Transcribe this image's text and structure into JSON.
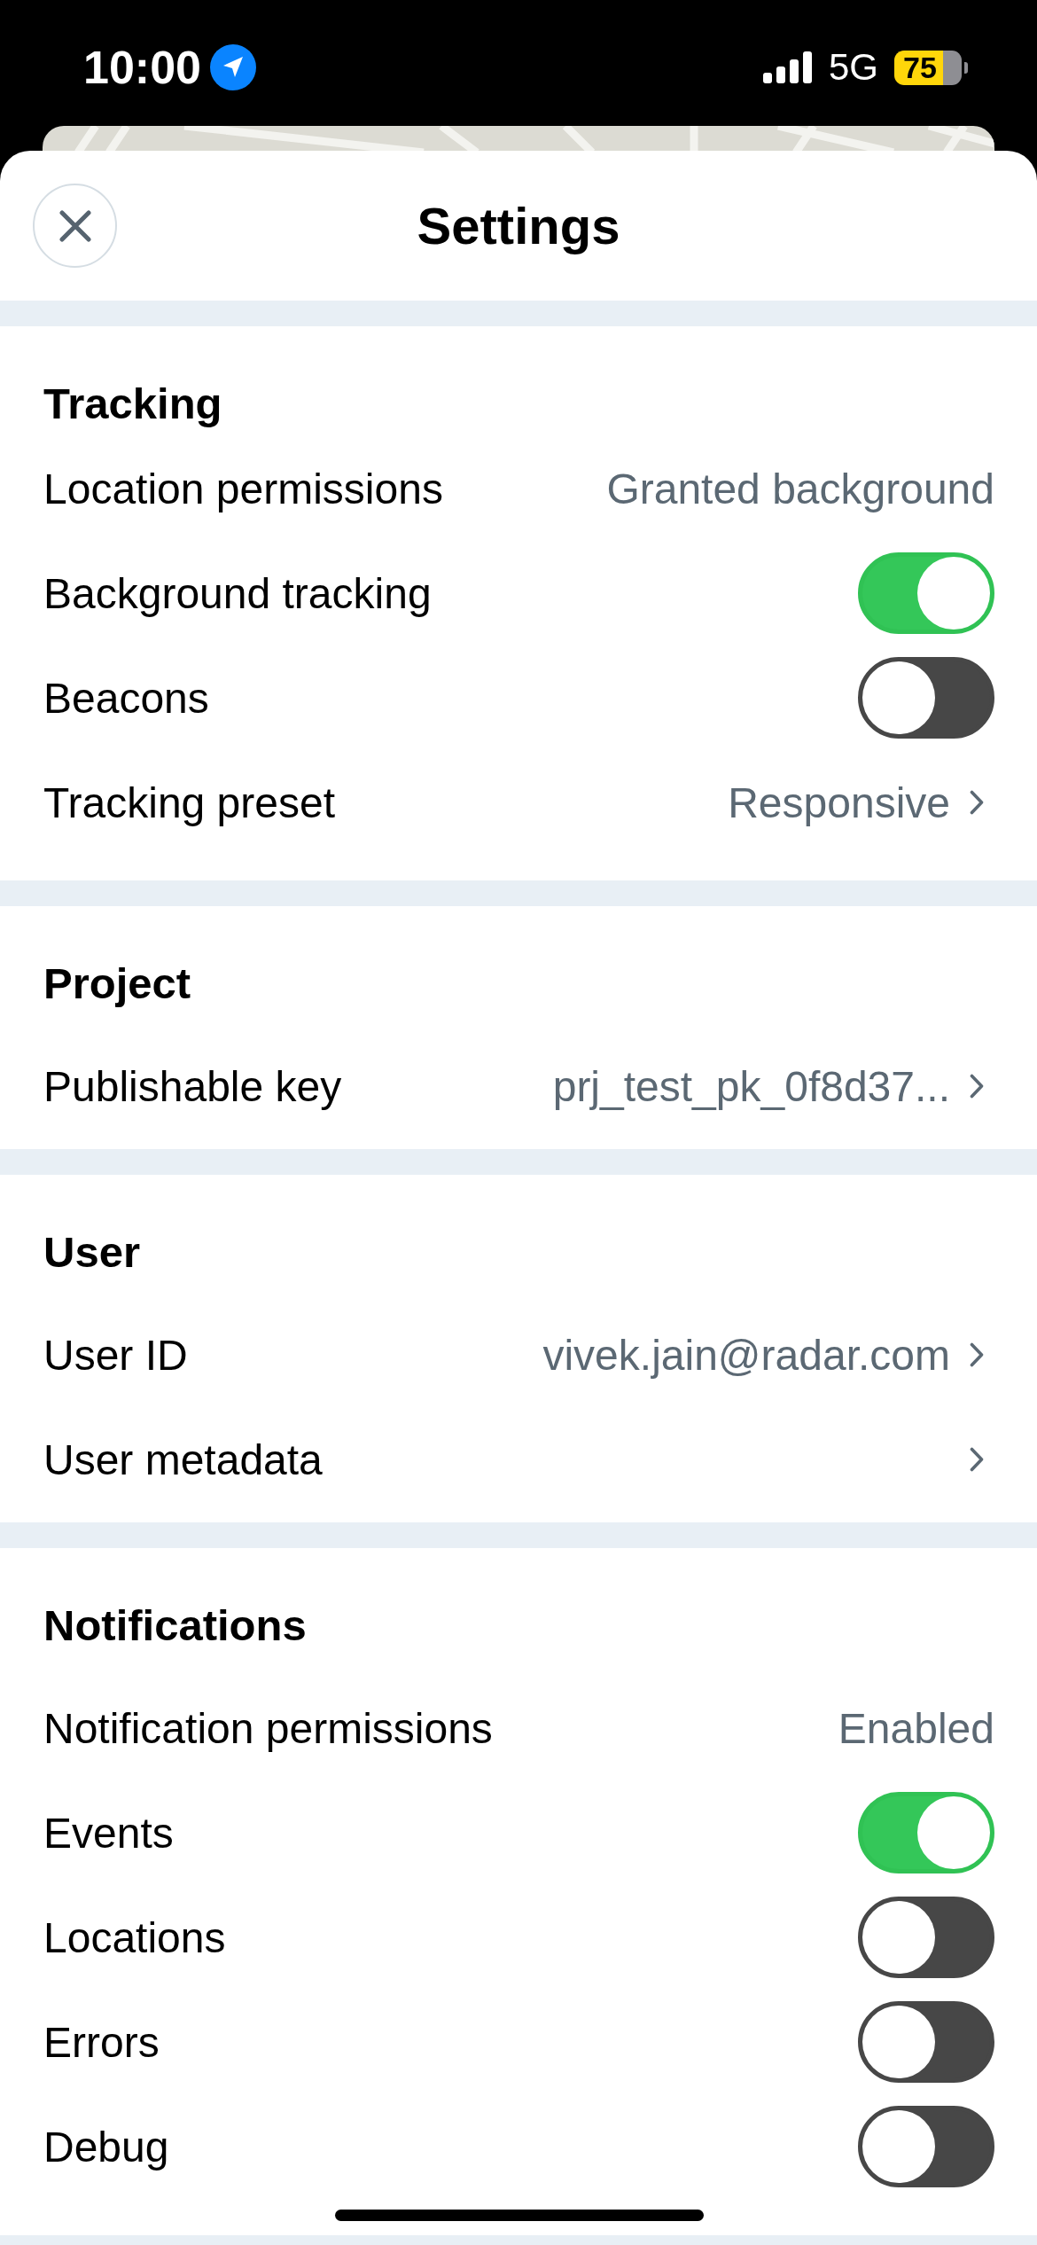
{
  "status_bar": {
    "time": "10:00",
    "network": "5G",
    "battery": "75"
  },
  "header": {
    "title": "Settings"
  },
  "sections": [
    {
      "title": "Tracking",
      "rows": [
        {
          "kind": "value",
          "label": "Location permissions",
          "value": "Granted background"
        },
        {
          "kind": "toggle",
          "label": "Background tracking",
          "on": true
        },
        {
          "kind": "toggle",
          "label": "Beacons",
          "on": false
        },
        {
          "kind": "link",
          "label": "Tracking preset",
          "value": "Responsive"
        }
      ]
    },
    {
      "title": "Project",
      "rows": [
        {
          "kind": "link",
          "label": "Publishable key",
          "value": "prj_test_pk_0f8d37..."
        }
      ]
    },
    {
      "title": "User",
      "rows": [
        {
          "kind": "link",
          "label": "User ID",
          "value": "vivek.jain@radar.com"
        },
        {
          "kind": "link",
          "label": "User metadata"
        }
      ]
    },
    {
      "title": "Notifications",
      "rows": [
        {
          "kind": "value",
          "label": "Notification permissions",
          "value": "Enabled"
        },
        {
          "kind": "toggle",
          "label": "Events",
          "on": true
        },
        {
          "kind": "toggle",
          "label": "Locations",
          "on": false
        },
        {
          "kind": "toggle",
          "label": "Errors",
          "on": false
        },
        {
          "kind": "toggle",
          "label": "Debug",
          "on": false
        }
      ]
    }
  ]
}
